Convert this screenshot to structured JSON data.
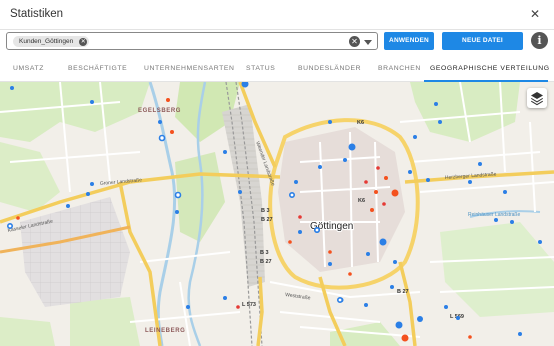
{
  "dialog": {
    "title": "Statistiken",
    "close_icon": "close-icon"
  },
  "filter": {
    "chip_label": "Kunden_Göttingen",
    "apply_label": "ANWENDEN",
    "file_label": "NEUE DATEI AUSWÄHLEN",
    "info_label": "i"
  },
  "tabs": [
    {
      "label": "UMSATZ"
    },
    {
      "label": "BESCHÄFTIGTE"
    },
    {
      "label": "UNTERNEHMENSARTEN"
    },
    {
      "label": "STATUS"
    },
    {
      "label": "BUNDESLÄNDER"
    },
    {
      "label": "BRANCHEN"
    },
    {
      "label": "GEOGRAPHISCHE VERTEILUNG"
    }
  ],
  "active_tab": "GEOGRAPHISCHE VERTEILUNG",
  "map": {
    "city_label": "Göttingen",
    "districts": [
      "EGELSBERG",
      "LEINEBERG"
    ],
    "streets": [
      "Groner Landstraße",
      "Kasseler Landstraße",
      "Herzberger Landstraße",
      "Weender Landstraße",
      "Weststraße",
      "Reinhäuser Landstraße"
    ],
    "road_refs": [
      "K6",
      "K6",
      "B 3",
      "B 27",
      "B 3",
      "B 27",
      "L 573",
      "B 27",
      "L 569"
    ],
    "colors": {
      "blue_marker": "#2b7fe6",
      "orange_marker": "#f4511e",
      "red_marker": "#e53935",
      "accent": "#1e88e5"
    },
    "layers_icon": "layers-icon"
  }
}
